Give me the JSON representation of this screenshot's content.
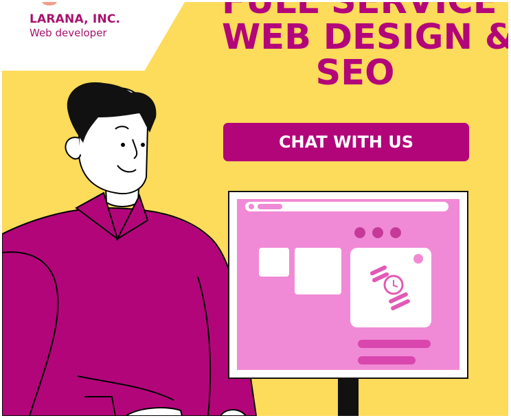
{
  "brand": {
    "name": "LARANA, INC.",
    "tagline": "Web developer"
  },
  "headline": {
    "lines": [
      "FULL SERVICE",
      "WEB DESIGN &",
      "SEO"
    ]
  },
  "cta": {
    "label": "CHAT WITH US"
  },
  "colors": {
    "background": "#fddb5b",
    "accent": "#b3057a",
    "screen": "#f08ad6"
  }
}
